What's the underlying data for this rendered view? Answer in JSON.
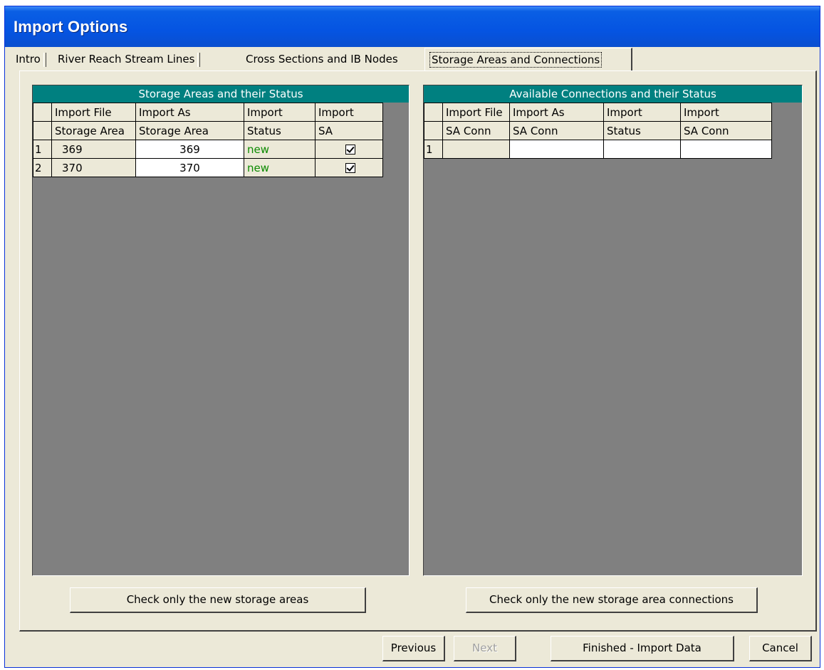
{
  "window": {
    "title": "Import Options"
  },
  "tabs": [
    {
      "label": "Intro"
    },
    {
      "label": "River Reach Stream Lines"
    },
    {
      "label": "Cross Sections and IB Nodes"
    },
    {
      "label": "Storage Areas and Connections",
      "selected": true
    }
  ],
  "storage_areas": {
    "header": "Storage Areas and their Status",
    "columns": [
      {
        "line1": "Import File",
        "line2": "Storage Area"
      },
      {
        "line1": "Import As",
        "line2": "Storage Area"
      },
      {
        "line1": "Import",
        "line2": "Status"
      },
      {
        "line1": "Import",
        "line2": "SA"
      }
    ],
    "rows": [
      {
        "num": "1",
        "import_file": "369",
        "import_as": "369",
        "status": "new",
        "checked": true
      },
      {
        "num": "2",
        "import_file": "370",
        "import_as": "370",
        "status": "new",
        "checked": true
      }
    ],
    "button_label": "Check only the new storage areas"
  },
  "connections": {
    "header": "Available Connections and their Status",
    "columns": [
      {
        "line1": "Import File",
        "line2": "SA Conn"
      },
      {
        "line1": "Import As",
        "line2": "SA Conn"
      },
      {
        "line1": "Import",
        "line2": "Status"
      },
      {
        "line1": "Import",
        "line2": "SA Conn"
      }
    ],
    "rows": [
      {
        "num": "1",
        "import_file": "",
        "import_as": "",
        "status": "",
        "import": ""
      }
    ],
    "button_label": "Check only the new storage area connections"
  },
  "footer": {
    "previous": "Previous",
    "next": "Next",
    "finish": "Finished - Import Data",
    "cancel": "Cancel"
  }
}
